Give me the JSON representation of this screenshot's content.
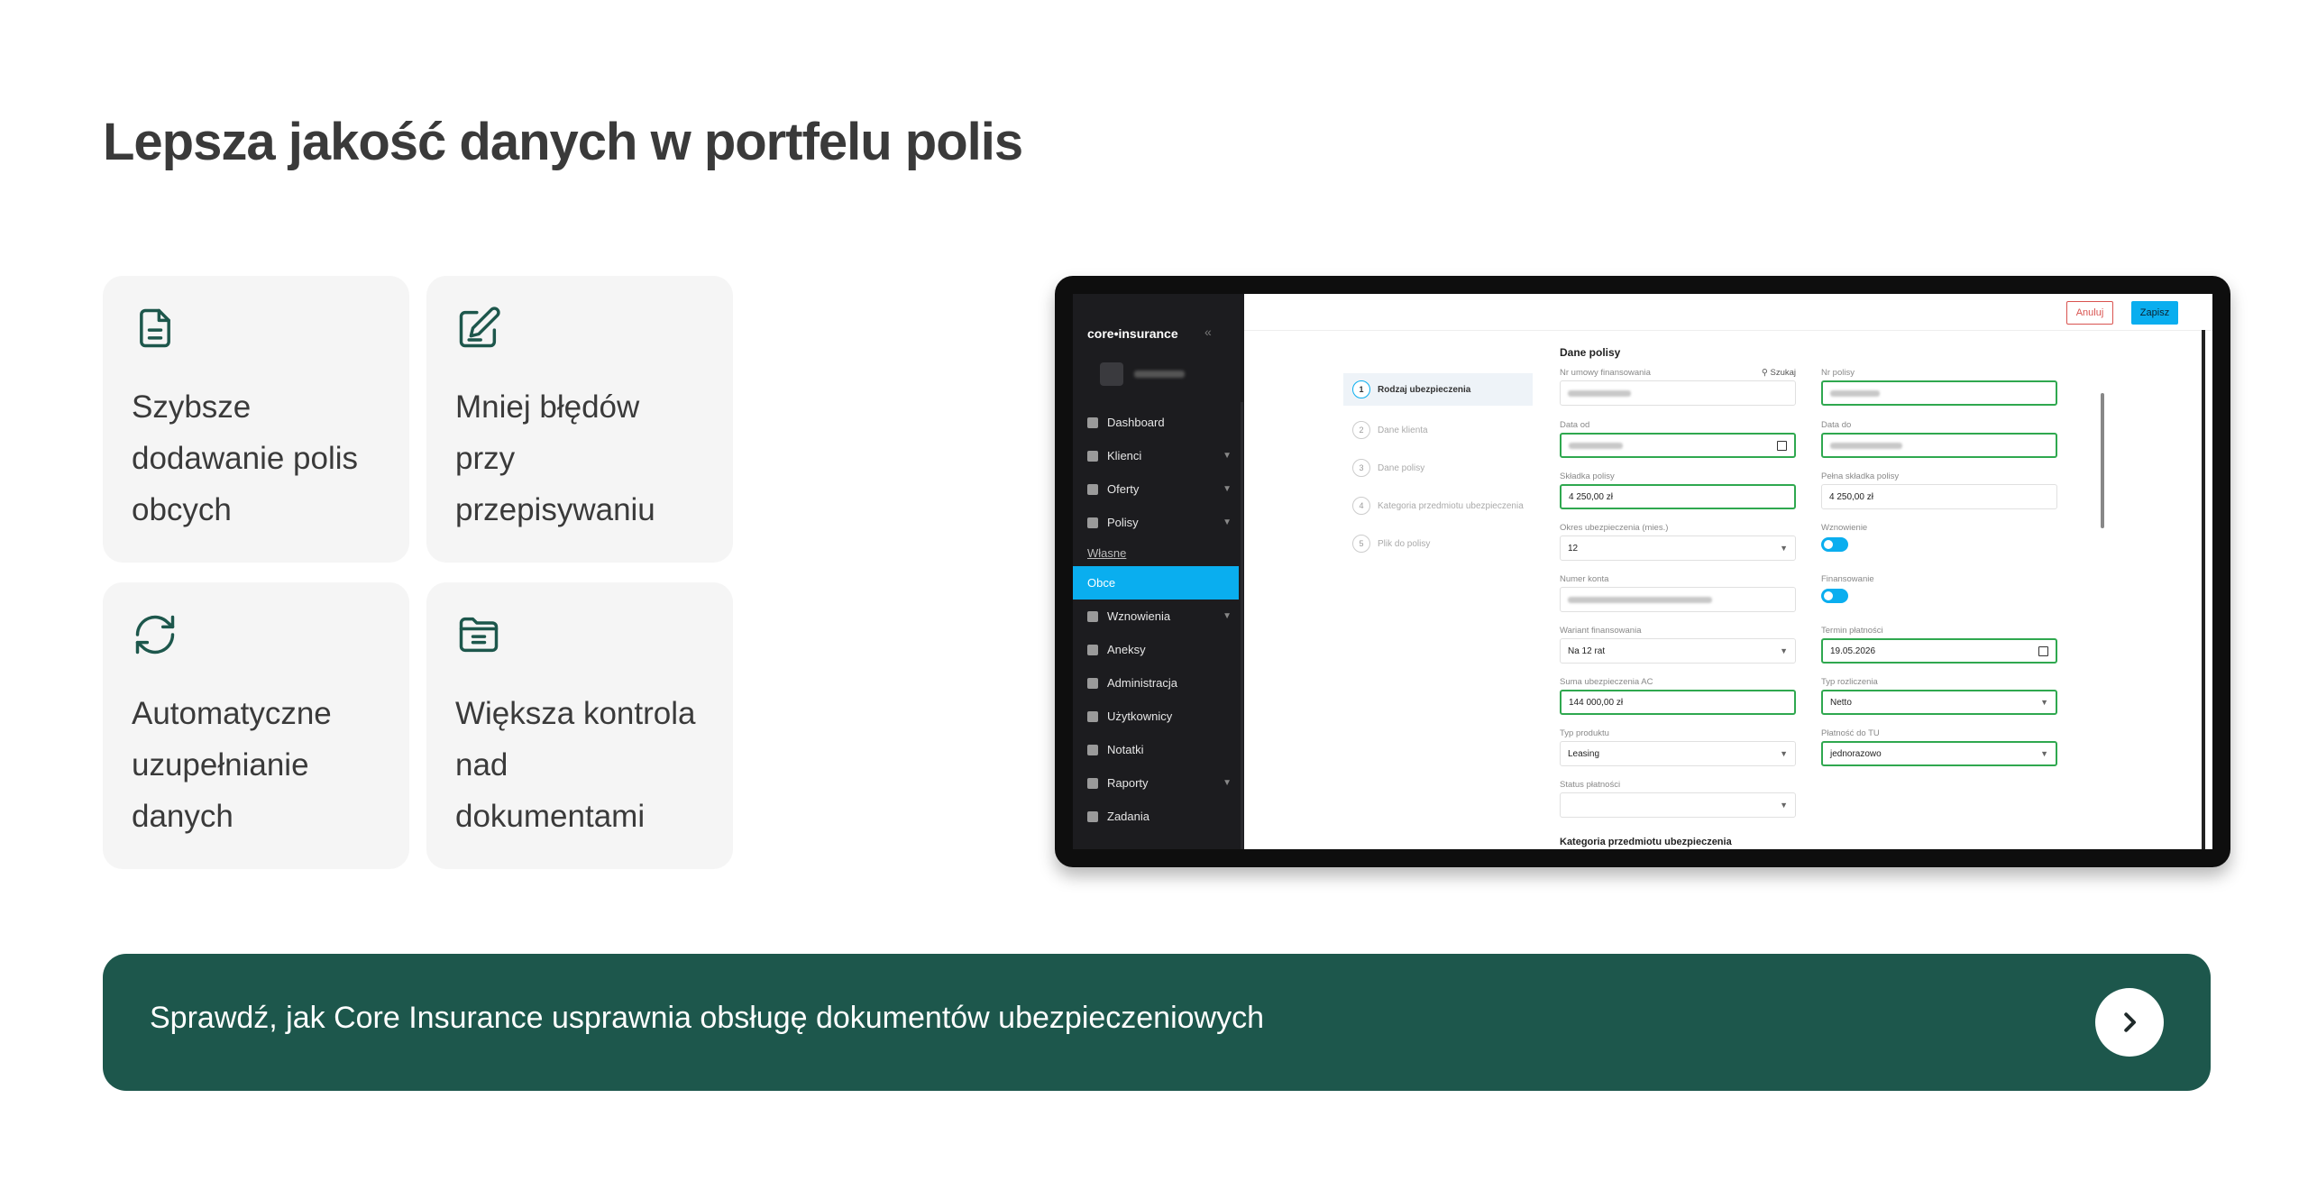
{
  "title": "Lepsza jakość danych w portfelu polis",
  "cards": [
    {
      "icon": "document-icon",
      "text": "Szybsze dodawanie polis obcych"
    },
    {
      "icon": "edit-icon",
      "text": "Mniej błędów przy przepisywaniu"
    },
    {
      "icon": "refresh-icon",
      "text": "Automatyczne uzupełnianie danych"
    },
    {
      "icon": "folder-icon",
      "text": "Większa kontrola nad dokumentami"
    }
  ],
  "app": {
    "logo": "core•insurance",
    "collapse": "«",
    "nav": {
      "dashboard": "Dashboard",
      "klienci": "Klienci",
      "oferty": "Oferty",
      "polisy": "Polisy",
      "wlasne": "Własne",
      "obce": "Obce",
      "wznowienia": "Wznowienia",
      "aneksy": "Aneksy",
      "administracja": "Administracja",
      "uzytkownicy": "Użytkownicy",
      "notatki": "Notatki",
      "raporty": "Raporty",
      "zadania": "Zadania"
    },
    "buttons": {
      "cancel": "Anuluj",
      "save": "Zapisz"
    },
    "steps": [
      {
        "num": "1",
        "label": "Rodzaj ubezpieczenia"
      },
      {
        "num": "2",
        "label": "Dane klienta"
      },
      {
        "num": "3",
        "label": "Dane polisy"
      },
      {
        "num": "4",
        "label": "Kategoria przedmiotu ubezpieczenia"
      },
      {
        "num": "5",
        "label": "Plik do polisy"
      }
    ],
    "section_title": "Dane polisy",
    "search_link": "Szukaj",
    "fields": {
      "nr_umowy": {
        "label": "Nr umowy finansowania"
      },
      "nr_polisy": {
        "label": "Nr polisy"
      },
      "data_od": {
        "label": "Data od"
      },
      "data_do": {
        "label": "Data do"
      },
      "skladka": {
        "label": "Składka polisy",
        "value": "4 250,00 zł"
      },
      "pelna_skladka": {
        "label": "Pełna składka polisy",
        "value": "4 250,00 zł"
      },
      "okres": {
        "label": "Okres ubezpieczenia (mies.)",
        "value": "12"
      },
      "wznowienie": {
        "label": "Wznowienie"
      },
      "numer_konta": {
        "label": "Numer konta"
      },
      "finansowanie": {
        "label": "Finansowanie"
      },
      "wariant": {
        "label": "Wariant finansowania",
        "value": "Na 12 rat"
      },
      "termin": {
        "label": "Termin płatności",
        "value": "19.05.2026"
      },
      "suma": {
        "label": "Suma ubezpieczenia AC",
        "value": "144 000,00 zł"
      },
      "typ_rozliczenia": {
        "label": "Typ rozliczenia",
        "value": "Netto"
      },
      "typ_produktu": {
        "label": "Typ produktu",
        "value": "Leasing"
      },
      "platnosc": {
        "label": "Płatność do TU",
        "value": "jednorazowo"
      },
      "status": {
        "label": "Status płatności"
      }
    },
    "bottom_section": "Kategoria przedmiotu ubezpieczenia"
  },
  "cta": {
    "text": "Sprawdź, jak Core Insurance usprawnia obsługę dokumentów ubezpieczeniowych",
    "icon": "chevron-right-icon"
  },
  "colors": {
    "accent_green": "#1d574c",
    "icon_green": "#1d574c",
    "app_blue": "#0aaeef",
    "field_green": "#2fa84f"
  }
}
